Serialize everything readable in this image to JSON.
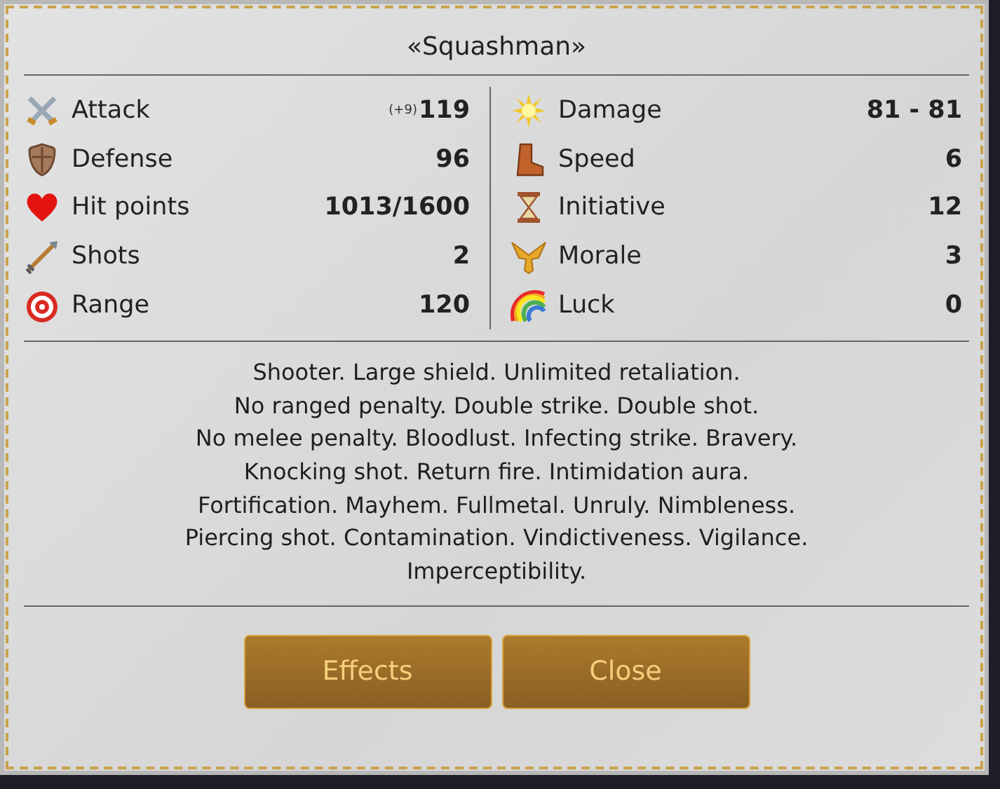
{
  "title": "«Squashman»",
  "stats_left": [
    {
      "kind": "attack",
      "label": "Attack",
      "bonus": "(+9)",
      "value": "119"
    },
    {
      "kind": "defense",
      "label": "Defense",
      "value": "96"
    },
    {
      "kind": "health",
      "label": "Hit points",
      "value": "1013/1600"
    },
    {
      "kind": "shots",
      "label": "Shots",
      "value": "2"
    },
    {
      "kind": "range",
      "label": "Range",
      "value": "120"
    }
  ],
  "stats_right": [
    {
      "kind": "damage",
      "label": "Damage",
      "value": "81 - 81"
    },
    {
      "kind": "speed",
      "label": "Speed",
      "value": "6"
    },
    {
      "kind": "initiative",
      "label": "Initiative",
      "value": "12"
    },
    {
      "kind": "morale",
      "label": "Morale",
      "value": "3"
    },
    {
      "kind": "luck",
      "label": "Luck",
      "value": "0"
    }
  ],
  "abilities": [
    "Shooter. Large shield. Unlimited retaliation.",
    "No ranged penalty. Double strike. Double shot.",
    "No melee penalty. Bloodlust. Infecting strike. Bravery.",
    "Knocking shot. Return fire. Intimidation aura.",
    "Fortification. Mayhem. Fullmetal. Unruly. Nimbleness.",
    "Piercing shot. Contamination. Vindictiveness. Vigilance.",
    "Imperceptibility."
  ],
  "buttons": [
    {
      "label": "Effects"
    },
    {
      "label": "Close"
    }
  ]
}
